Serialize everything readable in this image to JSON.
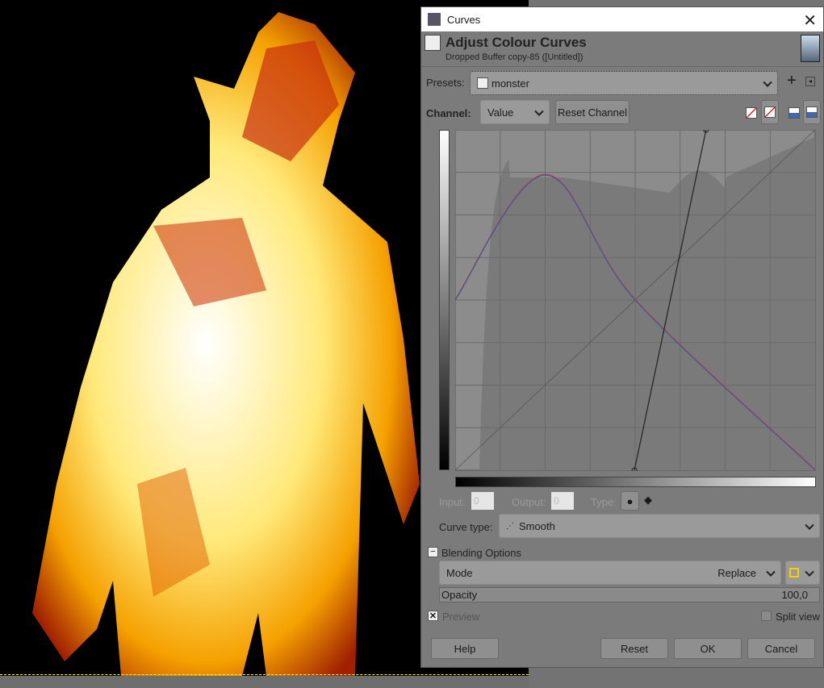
{
  "dialog": {
    "title": "Curves",
    "header_title": "Adjust Colour Curves",
    "header_subtitle": "Dropped Buffer copy-85 ([Untitled])"
  },
  "presets": {
    "label": "Presets:",
    "value": "monster"
  },
  "channel": {
    "label": "Channel:",
    "value": "Value",
    "reset_label": "Reset Channel"
  },
  "point": {
    "input_label": "Input:",
    "input_value": "0",
    "output_label": "Output:",
    "output_value": "0",
    "type_label": "Type:"
  },
  "curve_type": {
    "label": "Curve type:",
    "value": "Smooth"
  },
  "blending": {
    "label": "Blending Options",
    "mode_label": "Mode",
    "mode_value": "Replace",
    "opacity_label": "Opacity",
    "opacity_value": "100,0"
  },
  "preview": {
    "label": "Preview",
    "checked": true
  },
  "split_view": {
    "label": "Split view",
    "checked": false
  },
  "buttons": {
    "help": "Help",
    "reset": "Reset",
    "ok": "OK",
    "cancel": "Cancel"
  },
  "curve": {
    "value_points": [
      [
        0.498,
        0
      ],
      [
        0.697,
        1
      ]
    ],
    "rgb_points": [
      [
        0,
        0.5
      ],
      [
        0.25,
        0.867
      ],
      [
        0.5,
        0.5
      ],
      [
        1,
        0
      ]
    ],
    "colors": {
      "value": "#222222",
      "red": "#d04040",
      "blue": "#3a5a9a"
    }
  }
}
